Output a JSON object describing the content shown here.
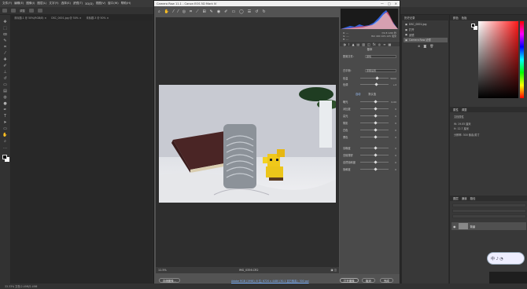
{
  "menubar": {
    "items": [
      "文件(F)",
      "编辑(E)",
      "图像(I)",
      "图层(L)",
      "文字(Y)",
      "选择(S)",
      "滤镜(T)",
      "3D(D)",
      "视图(V)",
      "窗口(W)",
      "帮助(H)"
    ]
  },
  "options_bar": {
    "text": "调整"
  },
  "doc_tabs": [
    "未标题-1 @ 50%(RGB/8) ×",
    "DSC_0001.jpg @ 50% ×",
    "未标题-3 @ 50% ×"
  ],
  "camera_raw": {
    "title": "Camera Raw 11.1  -  Canon EOS 5D Mark IV",
    "title_controls": [
      "—",
      "□",
      "×"
    ],
    "zoom": "11.5%",
    "filename": "IMG_0356.CR2",
    "workflow_link": "Adobe RGB (1998); 8 位; 6720 x 4480 (30.1 百万像素); 300 ppi",
    "buttons": {
      "save": "存储图像...",
      "open": "打开图像",
      "cancel": "取消",
      "done": "完成"
    },
    "readout": {
      "r": "R:  ---",
      "g": "G:  ---",
      "b": "B:  ---",
      "exif1": "f/2.8  1/60 秒",
      "exif2": "ISO 400  105-105 毫米"
    },
    "panel_title": "基本",
    "profile_label": "配置文件:",
    "profile_value": "颜色",
    "wb_label": "白平衡:",
    "wb_value": "原照设置",
    "sliders": [
      {
        "label": "色温",
        "value": "5000",
        "pos": 0.55
      },
      {
        "label": "色调",
        "value": "+4",
        "pos": 0.52
      },
      {
        "label": "曝光",
        "value": "0.00",
        "pos": 0.5
      },
      {
        "label": "对比度",
        "value": "0",
        "pos": 0.5
      },
      {
        "label": "高光",
        "value": "0",
        "pos": 0.5
      },
      {
        "label": "阴影",
        "value": "0",
        "pos": 0.5
      },
      {
        "label": "白色",
        "value": "0",
        "pos": 0.5
      },
      {
        "label": "黑色",
        "value": "0",
        "pos": 0.5
      },
      {
        "label": "清晰度",
        "value": "0",
        "pos": 0.5
      },
      {
        "label": "去除薄雾",
        "value": "0",
        "pos": 0.5
      },
      {
        "label": "自然饱和度",
        "value": "0",
        "pos": 0.5
      },
      {
        "label": "饱和度",
        "value": "0",
        "pos": 0.5
      }
    ],
    "auto_label": "自动",
    "default_label": "默认值",
    "histogram_colors": [
      "#2d6cff",
      "#ff3b3b",
      "#e8e8e8"
    ]
  },
  "history": {
    "tab": "历史记录",
    "items": [
      "DSC_0001.jpg",
      "打开",
      "滤镜",
      "Camera Raw 滤镜"
    ]
  },
  "color": {
    "tabs": [
      "颜色",
      "色板"
    ],
    "fg": "#000000",
    "bg": "#ffffff"
  },
  "properties": {
    "tabs": [
      "属性",
      "调整"
    ],
    "title": "文档属性",
    "w": "W: 19.05 厘米",
    "h": "H: 12.7 厘米",
    "res": "分辨率: 300 像素/英寸"
  },
  "layers": {
    "tabs": [
      "图层",
      "通道",
      "路径"
    ],
    "layer_name": "背景"
  },
  "widget_text": "中 ♪ ◔",
  "status": {
    "text": "33.33%    文档:2.49M/2.49M"
  }
}
